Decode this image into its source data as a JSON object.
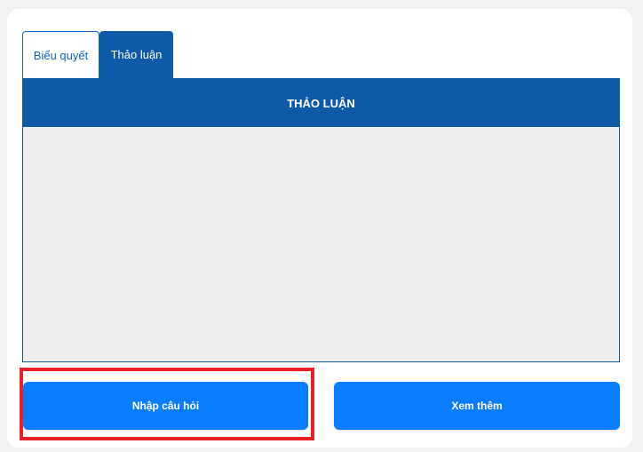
{
  "tabs": [
    {
      "label": "Biểu quyết",
      "active": false
    },
    {
      "label": "Thảo luận",
      "active": true
    }
  ],
  "panel": {
    "title": "THẢO LUẬN"
  },
  "actions": {
    "ask_label": "Nhập câu hỏi",
    "more_label": "Xem thêm"
  },
  "colors": {
    "primary": "#0e5aa7",
    "button": "#0a7cff",
    "highlight": "#e8202a",
    "panel_bg": "#efefef"
  }
}
